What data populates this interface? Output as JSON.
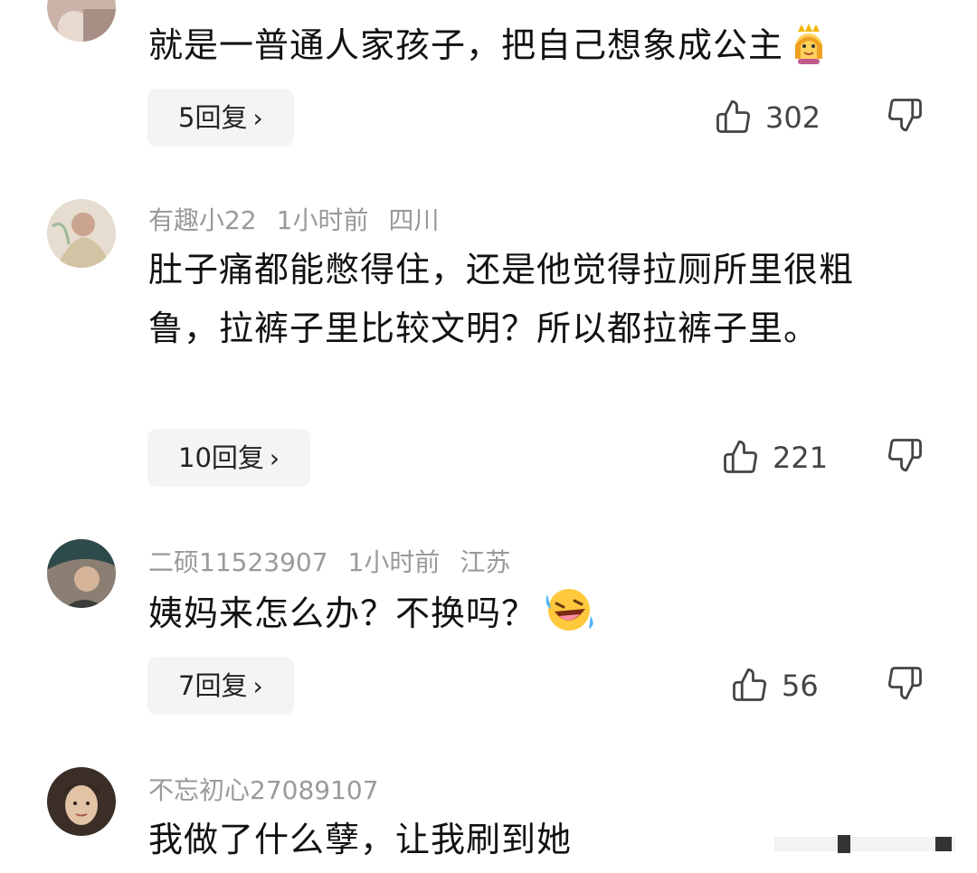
{
  "comments": [
    {
      "content": "就是一普通人家孩子，把自己想象成公主",
      "emoji": "princess-emoji",
      "reply_label": "5回复",
      "like_count": "302"
    },
    {
      "username": "有趣小22",
      "time": "1小时前",
      "location": "四川",
      "content": "肚子痛都能憋得住，还是他觉得拉厕所里很粗鲁，拉裤子里比较文明？所以都拉裤子里。",
      "reply_label": "10回复",
      "like_count": "221"
    },
    {
      "username": "二硕11523907",
      "time": "1小时前",
      "location": "江苏",
      "content": "姨妈来怎么办？不换吗？",
      "emoji": "rolling-laughing-emoji",
      "reply_label": "7回复",
      "like_count": "56"
    },
    {
      "username": "不忘初心27089107",
      "content": "我做了什么孽，让我刷到她"
    }
  ],
  "icons": {
    "like": "thumbs-up-icon",
    "dislike": "thumbs-down-icon",
    "chevron": "chevron-right-icon"
  },
  "colors": {
    "meta_text": "#9a9a9a",
    "body_text": "#111111",
    "pill_bg": "#f4f4f4"
  }
}
